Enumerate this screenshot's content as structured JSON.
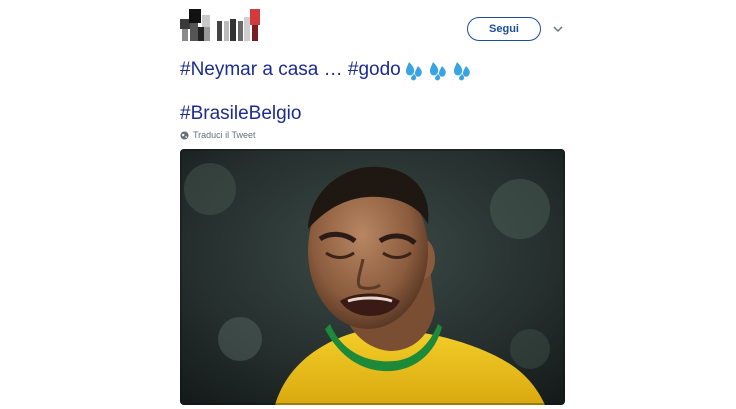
{
  "header": {
    "follow_label": "Segui"
  },
  "tweet": {
    "hashtag1": "#Neymar",
    "text1": " a casa … ",
    "hashtag2": "#godo",
    "hashtag3": "#BrasileBelgio"
  },
  "translate": {
    "label": "Traduci il Tweet"
  },
  "colors": {
    "link": "#1c2b8f",
    "follow_border": "#1b4f9c",
    "shirt_yellow": "#f2c718",
    "shirt_green": "#1d8a3a"
  },
  "icons": {
    "sweat_droplets": "sweat-droplets-emoji",
    "globe": "globe-icon",
    "chevron": "chevron-down-icon"
  }
}
